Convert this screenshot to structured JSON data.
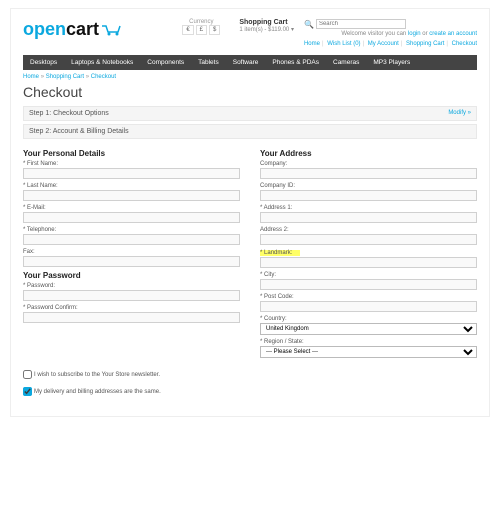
{
  "header": {
    "logo1": "open",
    "logo2": "cart",
    "currency_label": "Currency",
    "currencies": [
      "€",
      "£",
      "$"
    ],
    "cart_title": "Shopping Cart",
    "cart_items": "1 item(s) - $119.00",
    "search_placeholder": "Search",
    "welcome1": "Welcome visitor you can",
    "login": "login",
    "welcome2": "or",
    "create": "create an account",
    "links": [
      "Home",
      "Wish List (0)",
      "My Account",
      "Shopping Cart",
      "Checkout"
    ]
  },
  "nav": [
    "Desktops",
    "Laptops & Notebooks",
    "Components",
    "Tablets",
    "Software",
    "Phones & PDAs",
    "Cameras",
    "MP3 Players"
  ],
  "breadcrumb": [
    "Home",
    "Shopping Cart",
    "Checkout"
  ],
  "title": "Checkout",
  "modify": "Modify »",
  "steps": [
    "Step 1: Checkout Options",
    "Step 2: Account & Billing Details"
  ],
  "personal": {
    "heading": "Your Personal Details",
    "first": "First Name:",
    "last": "Last Name:",
    "email": "E-Mail:",
    "tel": "Telephone:",
    "fax": "Fax:"
  },
  "password": {
    "heading": "Your Password",
    "pw": "Password:",
    "pwc": "Password Confirm:"
  },
  "address": {
    "heading": "Your Address",
    "company": "Company:",
    "companyid": "Company ID:",
    "addr1": "Address 1:",
    "addr2": "Address 2:",
    "landmark": "Landmark:",
    "city": "City:",
    "post": "Post Code:",
    "country": "Country:",
    "country_val": "United Kingdom",
    "region": "Region / State:",
    "region_val": "--- Please Select ---"
  },
  "checks": {
    "newsletter": "I wish to subscribe to the Your Store newsletter.",
    "same": "My delivery and billing addresses are the same."
  }
}
